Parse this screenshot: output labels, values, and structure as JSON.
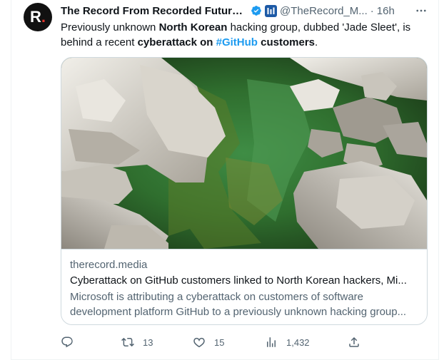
{
  "author": {
    "avatar_letter": "R",
    "avatar_dot": ".",
    "name": "The Record From Recorded Future ...",
    "handle": "@TheRecord_M...",
    "separator": "·",
    "time": "16h",
    "verified_icon": "verified-badge-icon",
    "affiliation_icon": "affiliate-logo-icon"
  },
  "tweet": {
    "parts": [
      {
        "text": "Previously unknown ",
        "style": "plain"
      },
      {
        "text": "North Korean",
        "style": "bold"
      },
      {
        "text": " hacking group, dubbed 'Jade Sleet', is behind a recent ",
        "style": "plain"
      },
      {
        "text": "cyberattack on ",
        "style": "bold"
      },
      {
        "text": "#GitHub",
        "style": "hashtag"
      },
      {
        "text": " customers",
        "style": "bold"
      },
      {
        "text": ".",
        "style": "plain"
      }
    ]
  },
  "card": {
    "domain": "therecord.media",
    "title": "Cyberattack on GitHub customers linked to North Korean hackers, Mi...",
    "description_line1": "Microsoft is attributing a cyberattack on customers of software",
    "description_line2": "development platform GitHub to a previously unknown hacking group..."
  },
  "actions": {
    "reply_count": "",
    "retweet_count": "13",
    "like_count": "15",
    "views_count": "1,432",
    "share_count": ""
  },
  "colors": {
    "accent": "#1d9bf0",
    "secondary_text": "#536471",
    "brand_red": "#e2342a"
  }
}
